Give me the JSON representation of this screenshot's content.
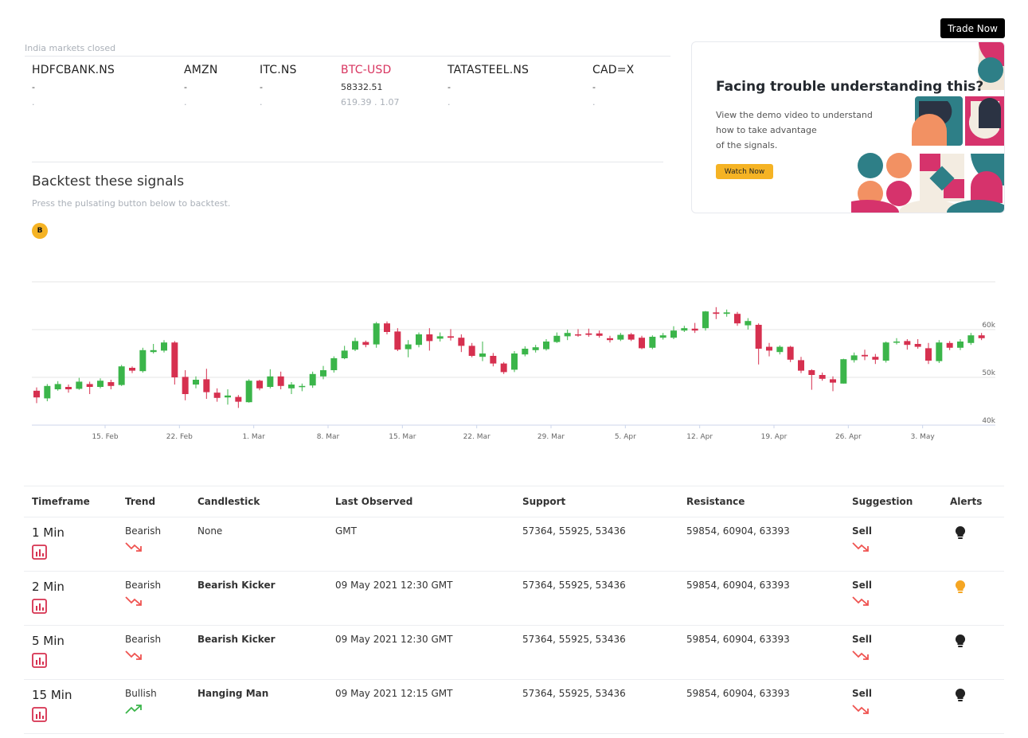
{
  "header": {
    "trade_now_label": "Trade Now"
  },
  "market": {
    "status": "India markets closed",
    "tickers": [
      {
        "symbol": "HDFCBANK.NS",
        "price": "-",
        "change": ".",
        "active": false
      },
      {
        "symbol": "AMZN",
        "price": "-",
        "change": ".",
        "active": false
      },
      {
        "symbol": "ITC.NS",
        "price": "-",
        "change": ".",
        "active": false
      },
      {
        "symbol": "BTC-USD",
        "price": "58332.51",
        "change": "619.39 . 1.07",
        "active": true
      },
      {
        "symbol": "TATASTEEL.NS",
        "price": "-",
        "change": ".",
        "active": false
      },
      {
        "symbol": "CAD=X",
        "price": "-",
        "change": ".",
        "active": false
      }
    ]
  },
  "backtest": {
    "title": "Backtest these signals",
    "subtitle": "Press the pulsating button below to backtest.",
    "button_label": "B"
  },
  "promo": {
    "title": "Facing trouble understanding this?",
    "desc_line1": "View the demo video to understand",
    "desc_line2": "how to take advantage",
    "desc_line3": "of the signals.",
    "watch_label": "Watch Now"
  },
  "chart_data": {
    "type": "candlestick",
    "x_tick_labels": [
      "15. Feb",
      "22. Feb",
      "1. Mar",
      "8. Mar",
      "15. Mar",
      "22. Mar",
      "29. Mar",
      "5. Apr",
      "12. Apr",
      "19. Apr",
      "26. Apr",
      "3. May"
    ],
    "y_tick_labels": [
      "40k",
      "50k",
      "60k"
    ],
    "ylim": [
      40000,
      70000
    ],
    "colors": {
      "up": "#3bb54a",
      "down": "#d6304f"
    },
    "candles": [
      {
        "o": 47200,
        "c": 45800,
        "h": 47900,
        "l": 44600
      },
      {
        "o": 45600,
        "c": 48200,
        "h": 48600,
        "l": 45000
      },
      {
        "o": 47500,
        "c": 48600,
        "h": 49200,
        "l": 47200
      },
      {
        "o": 48000,
        "c": 47500,
        "h": 48500,
        "l": 46800
      },
      {
        "o": 47600,
        "c": 49100,
        "h": 49900,
        "l": 47400
      },
      {
        "o": 48600,
        "c": 48000,
        "h": 49100,
        "l": 46500
      },
      {
        "o": 48000,
        "c": 49300,
        "h": 49800,
        "l": 47700
      },
      {
        "o": 49000,
        "c": 48200,
        "h": 49500,
        "l": 47500
      },
      {
        "o": 48400,
        "c": 52300,
        "h": 52600,
        "l": 48200
      },
      {
        "o": 52000,
        "c": 51400,
        "h": 52300,
        "l": 50900
      },
      {
        "o": 51300,
        "c": 55700,
        "h": 56200,
        "l": 51000
      },
      {
        "o": 55300,
        "c": 55700,
        "h": 57000,
        "l": 55000
      },
      {
        "o": 55600,
        "c": 57300,
        "h": 57800,
        "l": 55200
      },
      {
        "o": 57300,
        "c": 50000,
        "h": 57600,
        "l": 48500
      },
      {
        "o": 50100,
        "c": 46500,
        "h": 51500,
        "l": 45200
      },
      {
        "o": 48500,
        "c": 49500,
        "h": 50200,
        "l": 47700
      },
      {
        "o": 49600,
        "c": 46900,
        "h": 51800,
        "l": 45500
      },
      {
        "o": 46800,
        "c": 45700,
        "h": 47700,
        "l": 44900
      },
      {
        "o": 45800,
        "c": 46200,
        "h": 47500,
        "l": 44300
      },
      {
        "o": 45900,
        "c": 44900,
        "h": 46300,
        "l": 43600
      },
      {
        "o": 44800,
        "c": 49300,
        "h": 49600,
        "l": 44700
      },
      {
        "o": 49300,
        "c": 47700,
        "h": 49500,
        "l": 47300
      },
      {
        "o": 48000,
        "c": 50200,
        "h": 51700,
        "l": 47700
      },
      {
        "o": 50200,
        "c": 48200,
        "h": 51200,
        "l": 47500
      },
      {
        "o": 47700,
        "c": 48500,
        "h": 49000,
        "l": 46500
      },
      {
        "o": 48000,
        "c": 48200,
        "h": 48700,
        "l": 47100
      },
      {
        "o": 48300,
        "c": 50700,
        "h": 51200,
        "l": 47800
      },
      {
        "o": 50200,
        "c": 51500,
        "h": 52400,
        "l": 49600
      },
      {
        "o": 51500,
        "c": 54000,
        "h": 54400,
        "l": 51000
      },
      {
        "o": 54000,
        "c": 55600,
        "h": 56600,
        "l": 53800
      },
      {
        "o": 55800,
        "c": 57600,
        "h": 58300,
        "l": 55500
      },
      {
        "o": 57400,
        "c": 56800,
        "h": 57700,
        "l": 56300
      },
      {
        "o": 56900,
        "c": 61300,
        "h": 61600,
        "l": 56200
      },
      {
        "o": 61300,
        "c": 59500,
        "h": 61700,
        "l": 59000
      },
      {
        "o": 59600,
        "c": 55800,
        "h": 60300,
        "l": 55500
      },
      {
        "o": 55900,
        "c": 56900,
        "h": 57800,
        "l": 54200
      },
      {
        "o": 56800,
        "c": 59000,
        "h": 59400,
        "l": 56300
      },
      {
        "o": 59000,
        "c": 57600,
        "h": 60300,
        "l": 55600
      },
      {
        "o": 58100,
        "c": 58600,
        "h": 59400,
        "l": 57500
      },
      {
        "o": 58600,
        "c": 58300,
        "h": 60100,
        "l": 57700
      },
      {
        "o": 58300,
        "c": 56600,
        "h": 59000,
        "l": 55300
      },
      {
        "o": 56600,
        "c": 54500,
        "h": 57200,
        "l": 54200
      },
      {
        "o": 54300,
        "c": 55000,
        "h": 57500,
        "l": 53400
      },
      {
        "o": 54500,
        "c": 52900,
        "h": 55100,
        "l": 52300
      },
      {
        "o": 52900,
        "c": 51100,
        "h": 53200,
        "l": 50700
      },
      {
        "o": 51600,
        "c": 55000,
        "h": 55500,
        "l": 51100
      },
      {
        "o": 54800,
        "c": 56000,
        "h": 56500,
        "l": 54400
      },
      {
        "o": 55700,
        "c": 56300,
        "h": 56800,
        "l": 55200
      },
      {
        "o": 55900,
        "c": 57500,
        "h": 58000,
        "l": 55600
      },
      {
        "o": 57400,
        "c": 58700,
        "h": 59400,
        "l": 57200
      },
      {
        "o": 58600,
        "c": 59300,
        "h": 60000,
        "l": 57800
      },
      {
        "o": 59000,
        "c": 58900,
        "h": 60100,
        "l": 58500
      },
      {
        "o": 59200,
        "c": 58900,
        "h": 60200,
        "l": 58500
      },
      {
        "o": 59200,
        "c": 58700,
        "h": 59800,
        "l": 58300
      },
      {
        "o": 58200,
        "c": 57800,
        "h": 58700,
        "l": 57300
      },
      {
        "o": 57900,
        "c": 58900,
        "h": 59300,
        "l": 57600
      },
      {
        "o": 59000,
        "c": 57900,
        "h": 59300,
        "l": 57600
      },
      {
        "o": 58300,
        "c": 56100,
        "h": 58700,
        "l": 55900
      },
      {
        "o": 56200,
        "c": 58500,
        "h": 58800,
        "l": 55900
      },
      {
        "o": 58300,
        "c": 58800,
        "h": 59300,
        "l": 57900
      },
      {
        "o": 58300,
        "c": 59800,
        "h": 60700,
        "l": 58000
      },
      {
        "o": 59800,
        "c": 60300,
        "h": 60800,
        "l": 59500
      },
      {
        "o": 60200,
        "c": 59800,
        "h": 61400,
        "l": 59300
      },
      {
        "o": 60300,
        "c": 63800,
        "h": 63900,
        "l": 59800
      },
      {
        "o": 63600,
        "c": 63300,
        "h": 64700,
        "l": 62200
      },
      {
        "o": 63300,
        "c": 63600,
        "h": 64200,
        "l": 62700
      },
      {
        "o": 63300,
        "c": 61300,
        "h": 63700,
        "l": 60800
      },
      {
        "o": 60900,
        "c": 61800,
        "h": 62400,
        "l": 60000
      },
      {
        "o": 61000,
        "c": 56000,
        "h": 61300,
        "l": 52700
      },
      {
        "o": 56400,
        "c": 55600,
        "h": 57200,
        "l": 54400
      },
      {
        "o": 55300,
        "c": 56400,
        "h": 56700,
        "l": 54800
      },
      {
        "o": 56400,
        "c": 53700,
        "h": 56600,
        "l": 53200
      },
      {
        "o": 53600,
        "c": 51400,
        "h": 54300,
        "l": 50900
      },
      {
        "o": 51500,
        "c": 50500,
        "h": 51700,
        "l": 47400
      },
      {
        "o": 50500,
        "c": 49700,
        "h": 51000,
        "l": 49300
      },
      {
        "o": 49600,
        "c": 48900,
        "h": 50200,
        "l": 47100
      },
      {
        "o": 48700,
        "c": 53800,
        "h": 53900,
        "l": 48700
      },
      {
        "o": 53600,
        "c": 54600,
        "h": 55200,
        "l": 53100
      },
      {
        "o": 54700,
        "c": 54400,
        "h": 55800,
        "l": 53600
      },
      {
        "o": 54300,
        "c": 53700,
        "h": 54900,
        "l": 52800
      },
      {
        "o": 53500,
        "c": 57300,
        "h": 57500,
        "l": 53100
      },
      {
        "o": 57300,
        "c": 57500,
        "h": 58200,
        "l": 56900
      },
      {
        "o": 57600,
        "c": 56800,
        "h": 58000,
        "l": 55800
      },
      {
        "o": 57000,
        "c": 56400,
        "h": 58000,
        "l": 56000
      },
      {
        "o": 56100,
        "c": 53500,
        "h": 57200,
        "l": 52800
      },
      {
        "o": 53400,
        "c": 57300,
        "h": 57800,
        "l": 53000
      },
      {
        "o": 57200,
        "c": 56200,
        "h": 57600,
        "l": 55700
      },
      {
        "o": 56200,
        "c": 57500,
        "h": 58000,
        "l": 55700
      },
      {
        "o": 57200,
        "c": 58800,
        "h": 59300,
        "l": 56800
      },
      {
        "o": 58800,
        "c": 58200,
        "h": 59300,
        "l": 57800
      }
    ]
  },
  "table": {
    "headers": {
      "timeframe": "Timeframe",
      "trend": "Trend",
      "candlestick": "Candlestick",
      "last_observed": "Last Observed",
      "support": "Support",
      "resistance": "Resistance",
      "suggestion": "Suggestion",
      "alerts": "Alerts"
    },
    "rows": [
      {
        "timeframe": "1 Min",
        "trend": "Bearish",
        "candlestick": "None",
        "last_observed": "GMT",
        "support": "57364, 55925, 53436",
        "resistance": "59854, 60904, 63393",
        "suggestion": "Sell",
        "alert_color": "#222222"
      },
      {
        "timeframe": "2 Min",
        "trend": "Bearish",
        "candlestick": "Bearish Kicker",
        "last_observed": "09 May 2021 12:30 GMT",
        "support": "57364, 55925, 53436",
        "resistance": "59854, 60904, 63393",
        "suggestion": "Sell",
        "alert_color": "#f5a623"
      },
      {
        "timeframe": "5 Min",
        "trend": "Bearish",
        "candlestick": "Bearish Kicker",
        "last_observed": "09 May 2021 12:30 GMT",
        "support": "57364, 55925, 53436",
        "resistance": "59854, 60904, 63393",
        "suggestion": "Sell",
        "alert_color": "#222222"
      },
      {
        "timeframe": "15 Min",
        "trend": "Bullish",
        "candlestick": "Hanging Man",
        "last_observed": "09 May 2021 12:15 GMT",
        "support": "57364, 55925, 53436",
        "resistance": "59854, 60904, 63393",
        "suggestion": "Sell",
        "alert_color": "#222222"
      }
    ]
  }
}
